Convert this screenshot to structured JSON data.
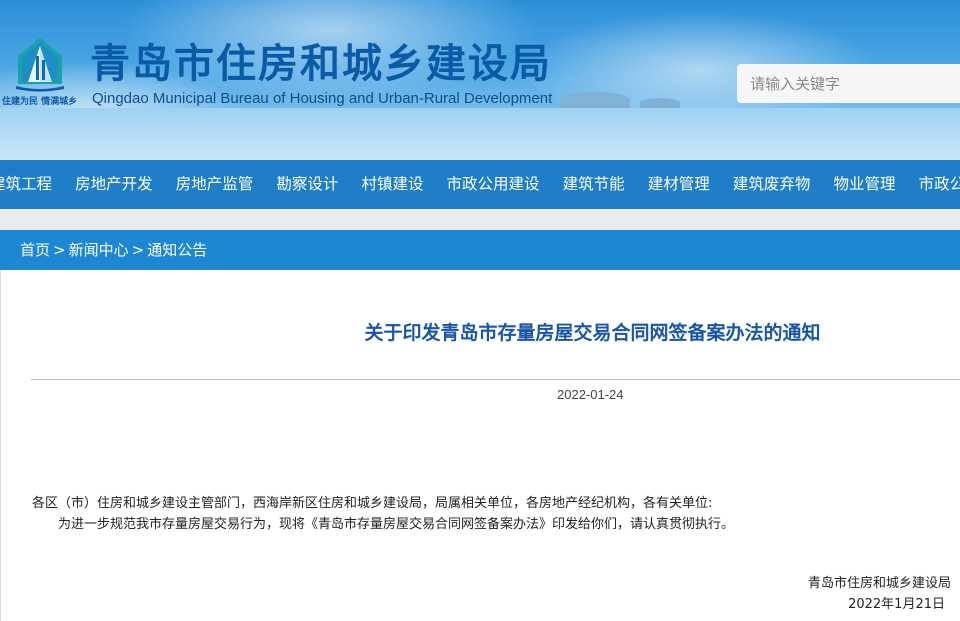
{
  "header": {
    "site_title": "青岛市住房和城乡建设局",
    "site_subtitle": "Qingdao Municipal Bureau of Housing and Urban-Rural Development",
    "logo_slogan": "住建为民 情满城乡",
    "search_placeholder": "请输入关键字"
  },
  "nav": {
    "items": [
      {
        "label": "建筑工程"
      },
      {
        "label": "房地产开发"
      },
      {
        "label": "房地产监管"
      },
      {
        "label": "勘察设计"
      },
      {
        "label": "村镇建设"
      },
      {
        "label": "市政公用建设"
      },
      {
        "label": "建筑节能"
      },
      {
        "label": "建材管理"
      },
      {
        "label": "建筑废弃物"
      },
      {
        "label": "物业管理"
      },
      {
        "label": "市政公用"
      }
    ]
  },
  "breadcrumb": {
    "home": "首页",
    "section": "新闻中心",
    "current": "通知公告",
    "separator": ">"
  },
  "article": {
    "title": "关于印发青岛市存量房屋交易合同网签备案办法的通知",
    "date": "2022-01-24",
    "recipients": "各区（市）住房和城乡建设主管部门，西海岸新区住房和城乡建设局，局属相关单位，各房地产经纪机构，各有关单位:",
    "body": "为进一步规范我市存量房屋交易行为，现将《青岛市存量房屋交易合同网签备案办法》印发给你们，请认真贯彻执行。",
    "signature_org": "青岛市住房和城乡建设局",
    "signature_date": "2022年1月21日"
  },
  "colors": {
    "nav_bg": "#1e7fc8",
    "breadcrumb_bg": "#1e87d4",
    "title_color": "#1a56a8",
    "logo_blue": "#0a5aa6"
  },
  "icons": {
    "logo": "city-emblem-icon"
  }
}
